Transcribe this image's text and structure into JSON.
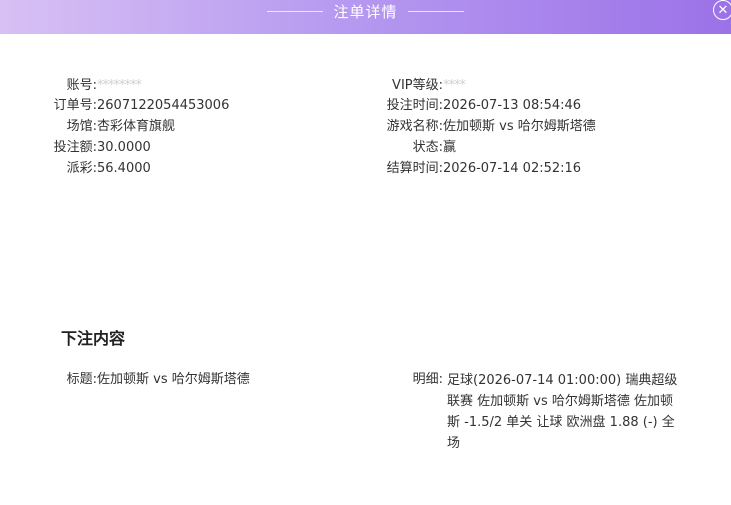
{
  "header": {
    "title": "注单详情",
    "close_glyph": "✕"
  },
  "info_left": [
    {
      "label": "账号:",
      "value": "********"
    },
    {
      "label": "订单号:",
      "value": "2607122054453006"
    },
    {
      "label": "场馆:",
      "value": "杏彩体育旗舰"
    },
    {
      "label": "投注额:",
      "value": "30.0000"
    },
    {
      "label": "派彩:",
      "value": "56.4000"
    }
  ],
  "info_right": [
    {
      "label": "VIP等级:",
      "value": "****"
    },
    {
      "label": "投注时间:",
      "value": "2026-07-13 08:54:46"
    },
    {
      "label": "游戏名称:",
      "value": "佐加顿斯 vs 哈尔姆斯塔德"
    },
    {
      "label": "状态:",
      "value": "赢"
    },
    {
      "label": "结算时间:",
      "value": "2026-07-14 02:52:16"
    }
  ],
  "bet_content": {
    "section_title": "下注内容",
    "title_label": "标题:",
    "title_value": "佐加顿斯 vs 哈尔姆斯塔德",
    "detail_label": "明细:",
    "detail_value": "足球(2026-07-14 01:00:00) 瑞典超级联赛 佐加顿斯 vs 哈尔姆斯塔德 佐加顿斯 -1.5/2 单关 让球 欧洲盘 1.88 (-) 全场"
  },
  "colors": {
    "header_start": "#d8c0f4",
    "header_end": "#9b72e8",
    "text": "#333333"
  }
}
